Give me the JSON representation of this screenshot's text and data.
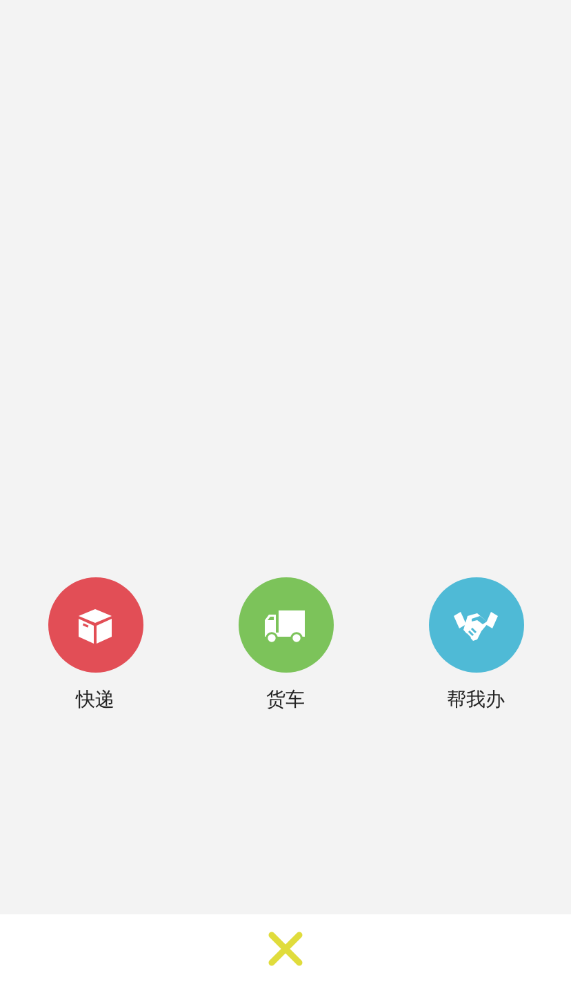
{
  "options": [
    {
      "label": "快递",
      "kind": "box",
      "color": "#e24e56"
    },
    {
      "label": "货车",
      "kind": "truck",
      "color": "#7cc35a"
    },
    {
      "label": "帮我办",
      "kind": "handshake",
      "color": "#4fbad6"
    }
  ]
}
